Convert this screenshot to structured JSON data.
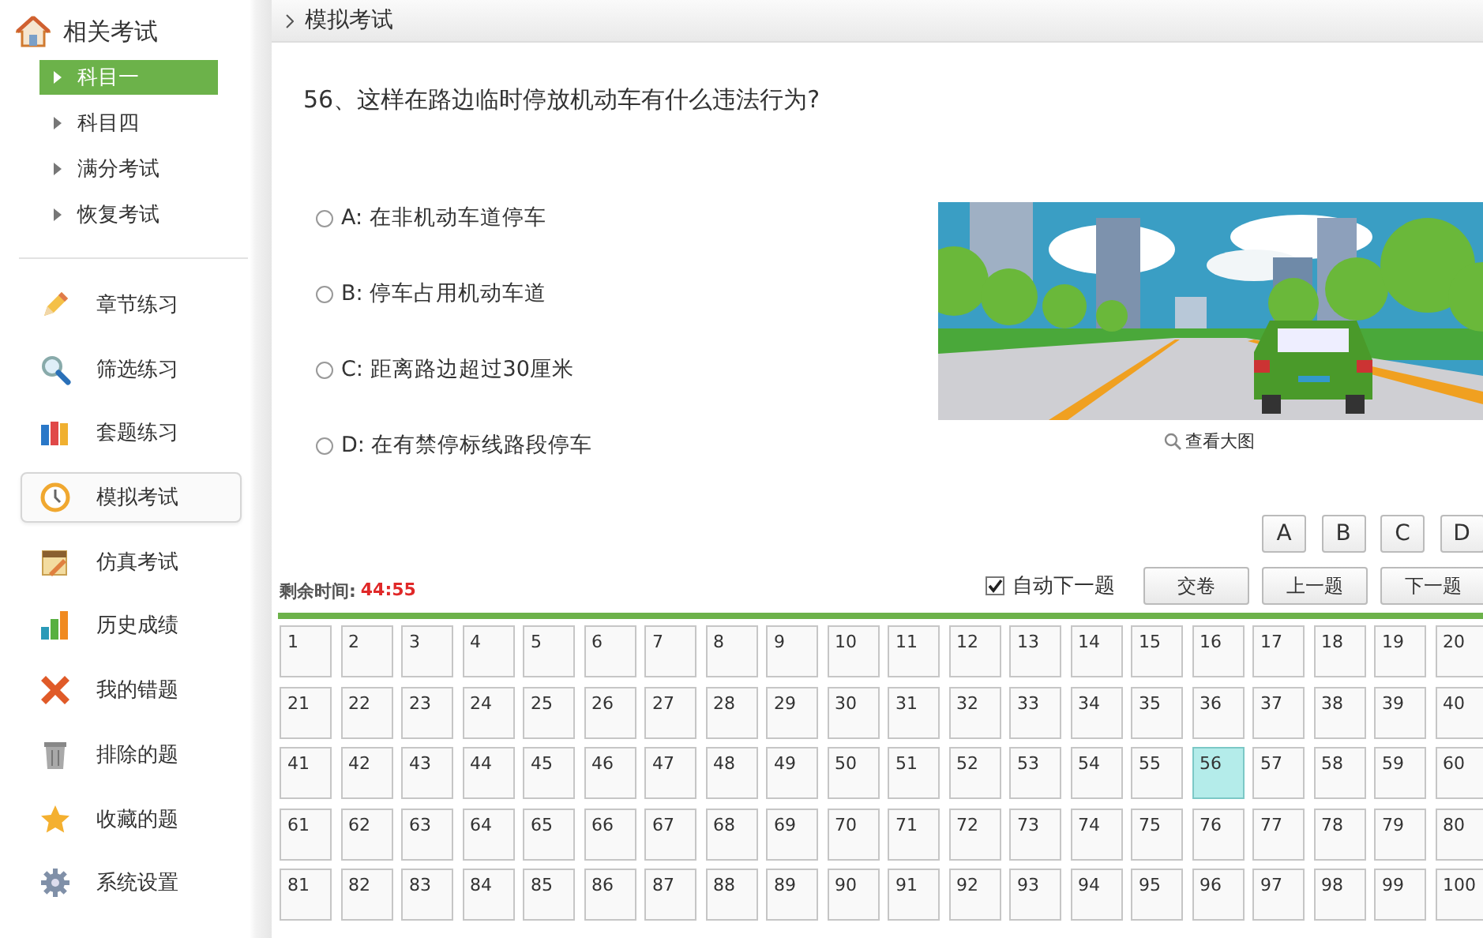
{
  "sidebar": {
    "header": "相关考试",
    "sub_items": [
      {
        "label": "科目一",
        "selected": true
      },
      {
        "label": "科目四",
        "selected": false
      },
      {
        "label": "满分考试",
        "selected": false
      },
      {
        "label": "恢复考试",
        "selected": false
      }
    ],
    "menu": [
      {
        "label": "章节练习",
        "kind": "pencil",
        "selected": false
      },
      {
        "label": "筛选练习",
        "kind": "magnifier",
        "selected": false
      },
      {
        "label": "套题练习",
        "kind": "books",
        "selected": false
      },
      {
        "label": "模拟考试",
        "kind": "clock",
        "selected": true
      },
      {
        "label": "仿真考试",
        "kind": "notepad",
        "selected": false
      },
      {
        "label": "历史成绩",
        "kind": "chart",
        "selected": false
      },
      {
        "label": "我的错题",
        "kind": "cross",
        "selected": false
      },
      {
        "label": "排除的题",
        "kind": "trash",
        "selected": false
      },
      {
        "label": "收藏的题",
        "kind": "star",
        "selected": false
      },
      {
        "label": "系统设置",
        "kind": "gear",
        "selected": false
      }
    ]
  },
  "breadcrumb": "模拟考试",
  "question": {
    "text": "56、这样在路边临时停放机动车有什么违法行为?",
    "options": [
      {
        "label": "A: 在非机动车道停车",
        "selected": false
      },
      {
        "label": "B: 停车占用机动车道",
        "selected": false
      },
      {
        "label": "C: 距离路边超过30厘米",
        "selected": false
      },
      {
        "label": "D: 在有禁停标线路段停车",
        "selected": false
      }
    ],
    "image_link": "查看大图"
  },
  "answer_buttons": [
    "A",
    "B",
    "C",
    "D"
  ],
  "timer": {
    "label": "剩余时间:",
    "value": "44:55"
  },
  "auto_next": {
    "label": "自动下一题",
    "checked": true
  },
  "actions": [
    "交卷",
    "上一题",
    "下一题"
  ],
  "grid": [
    {
      "number": "1",
      "selected": false
    },
    {
      "number": "2",
      "selected": false
    },
    {
      "number": "3",
      "selected": false
    },
    {
      "number": "4",
      "selected": false
    },
    {
      "number": "5",
      "selected": false
    },
    {
      "number": "6",
      "selected": false
    },
    {
      "number": "7",
      "selected": false
    },
    {
      "number": "8",
      "selected": false
    },
    {
      "number": "9",
      "selected": false
    },
    {
      "number": "10",
      "selected": false
    },
    {
      "number": "11",
      "selected": false
    },
    {
      "number": "12",
      "selected": false
    },
    {
      "number": "13",
      "selected": false
    },
    {
      "number": "14",
      "selected": false
    },
    {
      "number": "15",
      "selected": false
    },
    {
      "number": "16",
      "selected": false
    },
    {
      "number": "17",
      "selected": false
    },
    {
      "number": "18",
      "selected": false
    },
    {
      "number": "19",
      "selected": false
    },
    {
      "number": "20",
      "selected": false
    },
    {
      "number": "21",
      "selected": false
    },
    {
      "number": "22",
      "selected": false
    },
    {
      "number": "23",
      "selected": false
    },
    {
      "number": "24",
      "selected": false
    },
    {
      "number": "25",
      "selected": false
    },
    {
      "number": "26",
      "selected": false
    },
    {
      "number": "27",
      "selected": false
    },
    {
      "number": "28",
      "selected": false
    },
    {
      "number": "29",
      "selected": false
    },
    {
      "number": "30",
      "selected": false
    },
    {
      "number": "31",
      "selected": false
    },
    {
      "number": "32",
      "selected": false
    },
    {
      "number": "33",
      "selected": false
    },
    {
      "number": "34",
      "selected": false
    },
    {
      "number": "35",
      "selected": false
    },
    {
      "number": "36",
      "selected": false
    },
    {
      "number": "37",
      "selected": false
    },
    {
      "number": "38",
      "selected": false
    },
    {
      "number": "39",
      "selected": false
    },
    {
      "number": "40",
      "selected": false
    },
    {
      "number": "41",
      "selected": false
    },
    {
      "number": "42",
      "selected": false
    },
    {
      "number": "43",
      "selected": false
    },
    {
      "number": "44",
      "selected": false
    },
    {
      "number": "45",
      "selected": false
    },
    {
      "number": "46",
      "selected": false
    },
    {
      "number": "47",
      "selected": false
    },
    {
      "number": "48",
      "selected": false
    },
    {
      "number": "49",
      "selected": false
    },
    {
      "number": "50",
      "selected": false
    },
    {
      "number": "51",
      "selected": false
    },
    {
      "number": "52",
      "selected": false
    },
    {
      "number": "53",
      "selected": false
    },
    {
      "number": "54",
      "selected": false
    },
    {
      "number": "55",
      "selected": false
    },
    {
      "number": "56",
      "selected": true
    },
    {
      "number": "57",
      "selected": false
    },
    {
      "number": "58",
      "selected": false
    },
    {
      "number": "59",
      "selected": false
    },
    {
      "number": "60",
      "selected": false
    },
    {
      "number": "61",
      "selected": false
    },
    {
      "number": "62",
      "selected": false
    },
    {
      "number": "63",
      "selected": false
    },
    {
      "number": "64",
      "selected": false
    },
    {
      "number": "65",
      "selected": false
    },
    {
      "number": "66",
      "selected": false
    },
    {
      "number": "67",
      "selected": false
    },
    {
      "number": "68",
      "selected": false
    },
    {
      "number": "69",
      "selected": false
    },
    {
      "number": "70",
      "selected": false
    },
    {
      "number": "71",
      "selected": false
    },
    {
      "number": "72",
      "selected": false
    },
    {
      "number": "73",
      "selected": false
    },
    {
      "number": "74",
      "selected": false
    },
    {
      "number": "75",
      "selected": false
    },
    {
      "number": "76",
      "selected": false
    },
    {
      "number": "77",
      "selected": false
    },
    {
      "number": "78",
      "selected": false
    },
    {
      "number": "79",
      "selected": false
    },
    {
      "number": "80",
      "selected": false
    },
    {
      "number": "81",
      "selected": false
    },
    {
      "number": "82",
      "selected": false
    },
    {
      "number": "83",
      "selected": false
    },
    {
      "number": "84",
      "selected": false
    },
    {
      "number": "85",
      "selected": false
    },
    {
      "number": "86",
      "selected": false
    },
    {
      "number": "87",
      "selected": false
    },
    {
      "number": "88",
      "selected": false
    },
    {
      "number": "89",
      "selected": false
    },
    {
      "number": "90",
      "selected": false
    },
    {
      "number": "91",
      "selected": false
    },
    {
      "number": "92",
      "selected": false
    },
    {
      "number": "93",
      "selected": false
    },
    {
      "number": "94",
      "selected": false
    },
    {
      "number": "95",
      "selected": false
    },
    {
      "number": "96",
      "selected": false
    },
    {
      "number": "97",
      "selected": false
    },
    {
      "number": "98",
      "selected": false
    },
    {
      "number": "99",
      "selected": false
    },
    {
      "number": "100",
      "selected": false
    }
  ]
}
